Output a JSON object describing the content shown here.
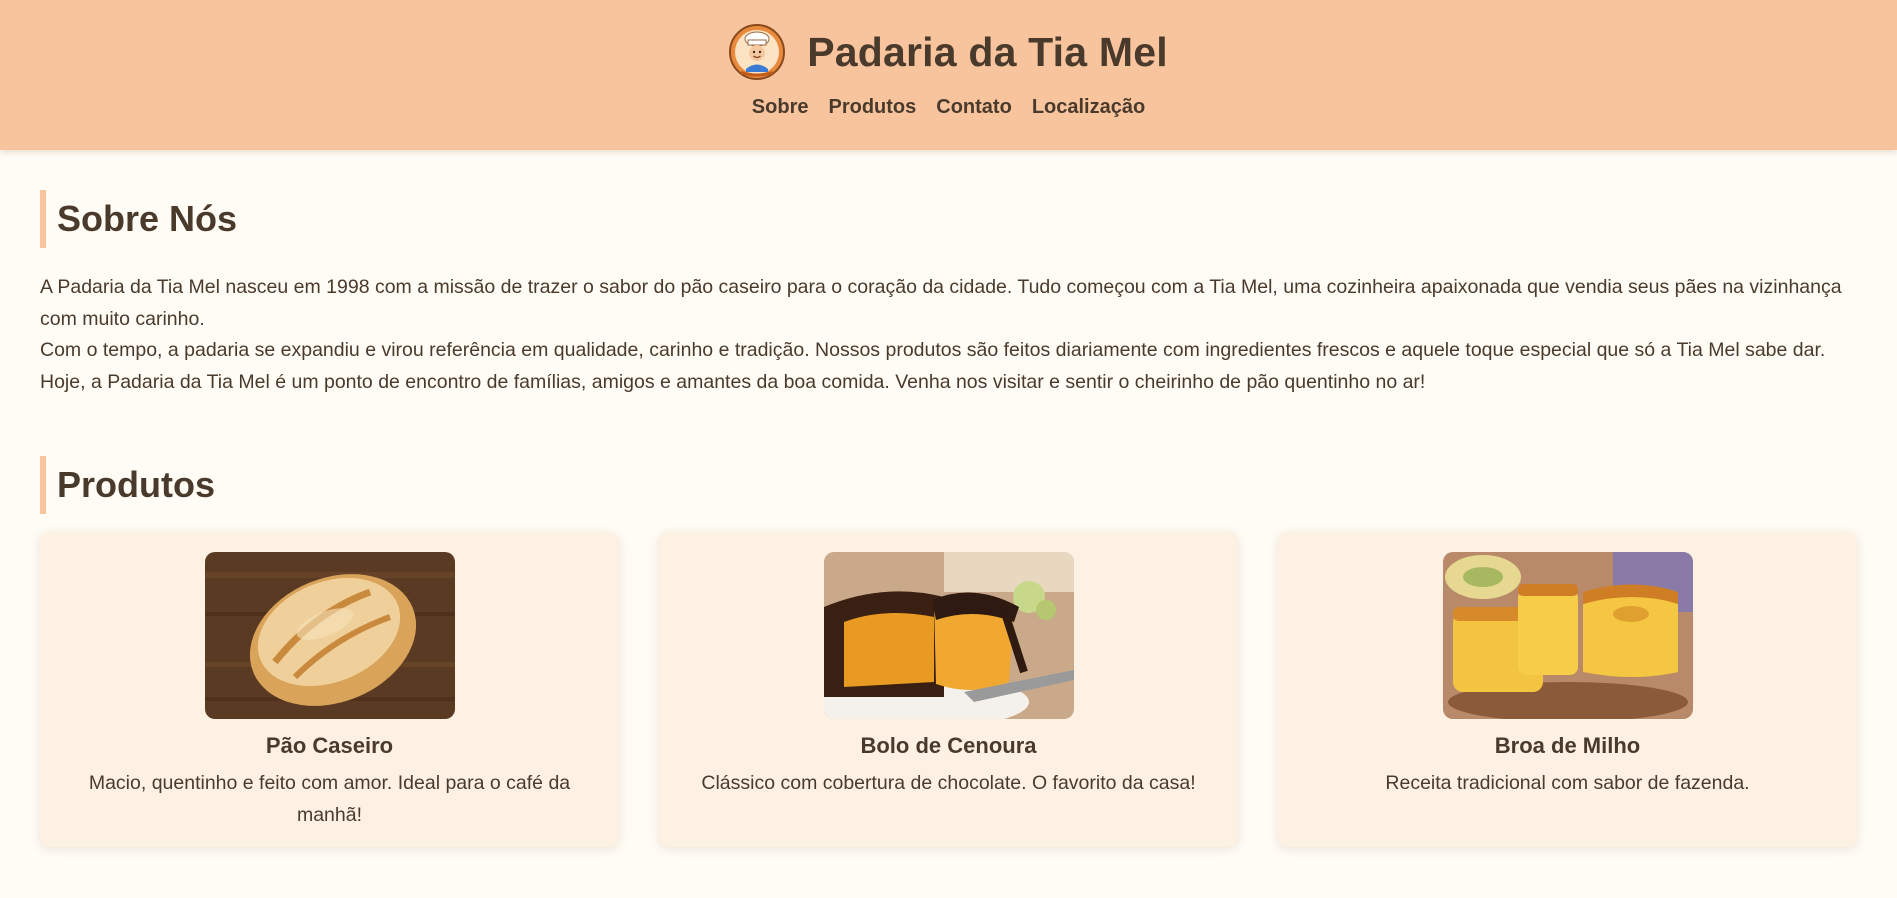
{
  "header": {
    "title": "Padaria da Tia Mel",
    "logo_icon": "chef-mascot-icon",
    "nav": [
      {
        "label": "Sobre"
      },
      {
        "label": "Produtos"
      },
      {
        "label": "Contato"
      },
      {
        "label": "Localização"
      }
    ]
  },
  "about": {
    "heading": "Sobre Nós",
    "paragraphs": [
      "A Padaria da Tia Mel nasceu em 1998 com a missão de trazer o sabor do pão caseiro para o coração da cidade. Tudo começou com a Tia Mel, uma cozinheira apaixonada que vendia seus pães na vizinhança com muito carinho.",
      "Com o tempo, a padaria se expandiu e virou referência em qualidade, carinho e tradição. Nossos produtos são feitos diariamente com ingredientes frescos e aquele toque especial que só a Tia Mel sabe dar.",
      "Hoje, a Padaria da Tia Mel é um ponto de encontro de famílias, amigos e amantes da boa comida. Venha nos visitar e sentir o cheirinho de pão quentinho no ar!"
    ]
  },
  "products": {
    "heading": "Produtos",
    "items": [
      {
        "name": "Pão Caseiro",
        "description": "Macio, quentinho e feito com amor. Ideal para o café da manhã!",
        "image_icon": "bread-loaf-photo"
      },
      {
        "name": "Bolo de Cenoura",
        "description": "Clássico com cobertura de chocolate. O favorito da casa!",
        "image_icon": "carrot-cake-photo"
      },
      {
        "name": "Broa de Milho",
        "description": "Receita tradicional com sabor de fazenda.",
        "image_icon": "corn-cake-photo"
      }
    ]
  },
  "colors": {
    "header_bg": "#f7c49e",
    "page_bg": "#fffcf5",
    "card_bg": "#fdf1e3",
    "text": "#4a3a2c"
  }
}
